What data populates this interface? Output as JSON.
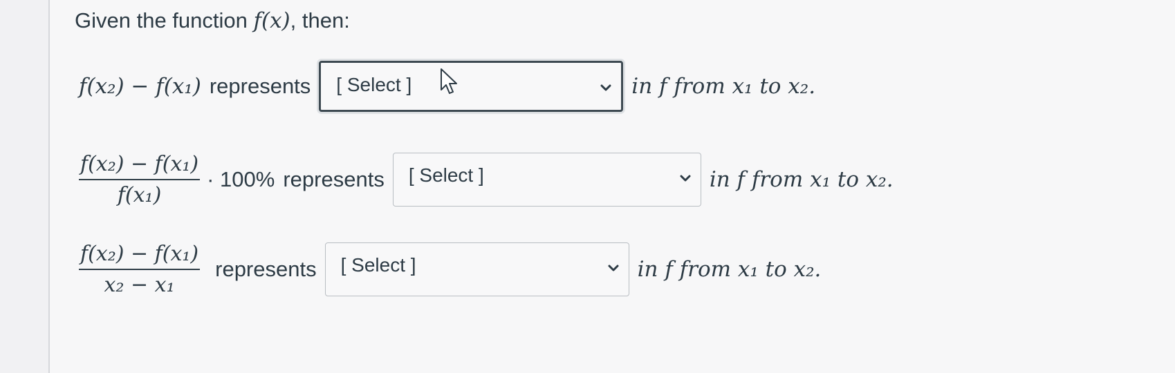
{
  "intro": {
    "prefix": "Given the function ",
    "func": "f(x)",
    "suffix": ", then:"
  },
  "rows": [
    {
      "expr": "f(x₂) − f(x₁)",
      "represents": "represents",
      "select_label": "[ Select ]",
      "trailing_text": "in f from x₁ to x₂."
    },
    {
      "numerator": "f(x₂) − f(x₁)",
      "denominator": "f(x₁)",
      "multiplier": "· 100%",
      "represents": "represents",
      "select_label": "[ Select ]",
      "trailing_text": "in f from x₁ to x₂."
    },
    {
      "numerator": "f(x₂) − f(x₁)",
      "denominator": "x₂ − x₁",
      "represents": "represents",
      "select_label": "[ Select ]",
      "trailing_text": "in f from x₁ to x₂."
    }
  ],
  "icons": {
    "dropdown": "chevron-down-icon",
    "pointer": "cursor-pointer-icon"
  },
  "colors": {
    "text": "#2d3b45",
    "select_border": "#b8bdc2",
    "focused_border": "#3e4a52",
    "background": "#f7f7f8"
  }
}
